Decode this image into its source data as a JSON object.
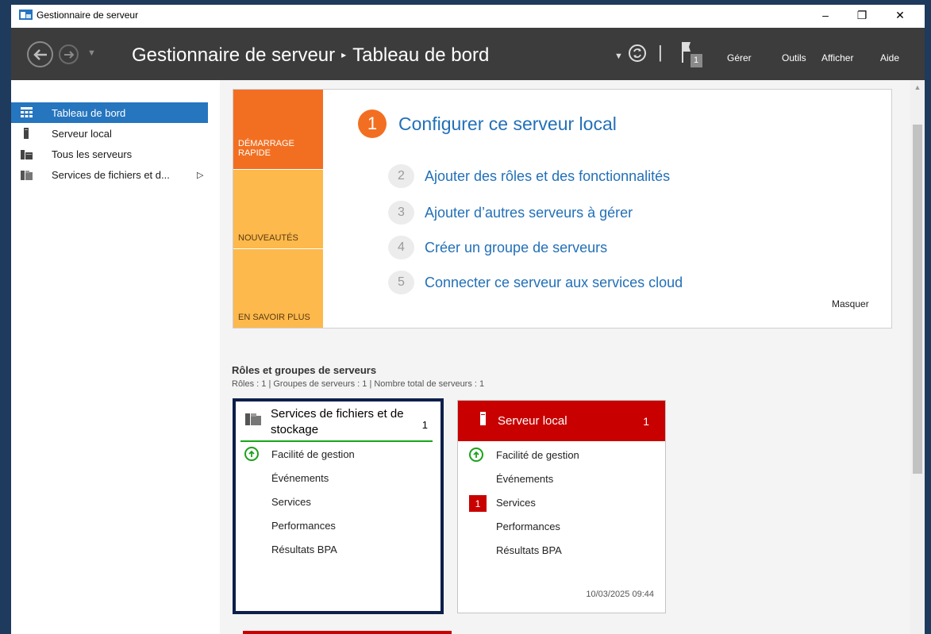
{
  "window": {
    "title": "Gestionnaire de serveur",
    "controls": {
      "minimize": "–",
      "maximize": "❐",
      "close": "✕"
    }
  },
  "header": {
    "breadcrumb_root": "Gestionnaire de serveur",
    "breadcrumb_sep": "▸",
    "breadcrumb_current": "Tableau de bord",
    "notification_count": "1",
    "menu": {
      "manage": "Gérer",
      "tools": "Outils",
      "view": "Afficher",
      "help": "Aide"
    }
  },
  "sidebar": {
    "items": [
      {
        "label": "Tableau de bord",
        "icon": "dashboard-icon",
        "active": true
      },
      {
        "label": "Serveur local",
        "icon": "server-icon"
      },
      {
        "label": "Tous les serveurs",
        "icon": "servers-icon"
      },
      {
        "label": "Services de fichiers et d...",
        "icon": "file-services-icon",
        "expandable": true
      }
    ]
  },
  "quickstart": {
    "tabs": [
      "DÉMARRAGE RAPIDE",
      "NOUVEAUTÉS",
      "EN SAVOIR PLUS"
    ],
    "main_step": {
      "num": "1",
      "label": "Configurer ce serveur local"
    },
    "steps": [
      {
        "num": "2",
        "label": "Ajouter des rôles et des fonctionnalités"
      },
      {
        "num": "3",
        "label": "Ajouter d’autres serveurs à gérer"
      },
      {
        "num": "4",
        "label": "Créer un groupe de serveurs"
      },
      {
        "num": "5",
        "label": "Connecter ce serveur aux services cloud"
      }
    ],
    "hide_label": "Masquer"
  },
  "roles": {
    "title": "Rôles et groupes de serveurs",
    "subtitle": "Rôles : 1   |   Groupes de serveurs : 1   |   Nombre total de serveurs : 1"
  },
  "cards": [
    {
      "title": "Services de fichiers et de stockage",
      "count": "1",
      "rows": [
        "Facilité de gestion",
        "Événements",
        "Services",
        "Performances",
        "Résultats BPA"
      ],
      "timestamp": ""
    },
    {
      "title": "Serveur local",
      "count": "1",
      "rows": [
        "Facilité de gestion",
        "Événements",
        "Services",
        "Performances",
        "Résultats BPA"
      ],
      "services_alert": "1",
      "timestamp": "10/03/2025 09:44"
    }
  ],
  "colors": {
    "header_bg": "#3c3c3c",
    "accent_blue": "#2675bf",
    "quickstart_orange": "#f26f21",
    "quickstart_yellow": "#fdb94c",
    "alert_red": "#c80000",
    "ok_green": "#1aa31a"
  }
}
